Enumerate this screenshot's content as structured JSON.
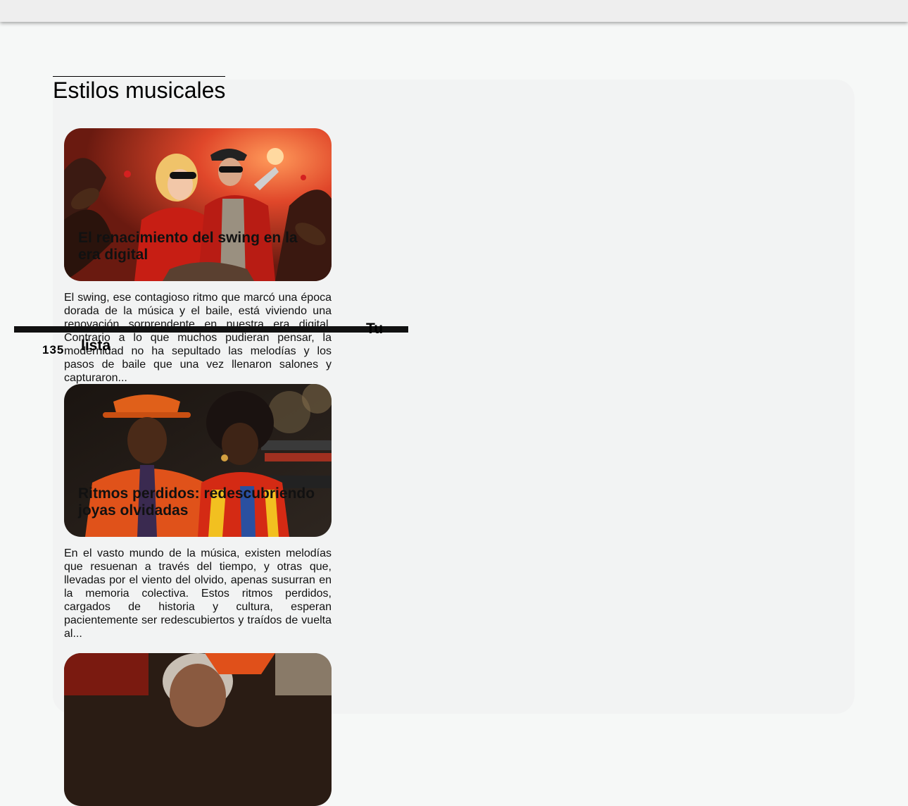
{
  "section": {
    "title": "Estilos musicales"
  },
  "articles": [
    {
      "title": "El renacimiento del swing en la era digital",
      "excerpt": "El swing, ese contagioso ritmo que marcó una época dorada de la música y el baile, está viviendo una renovación sorprendente en nuestra era digital. Contrario a lo que muchos pudieran pensar, la modernidad no ha sepultado las melodías y los pasos de baile que una vez llenaron salones y capturaron...",
      "image": "swing-couple-illustration"
    },
    {
      "title": "Ritmos perdidos: redescubriendo joyas olvidadas",
      "excerpt": "En el vasto mundo de la música, existen melodías que resuenan a través del tiempo, y otras que, llevadas por el viento del olvido, apenas susurran en la memoria colectiva. Estos ritmos perdidos, cargados de historia y cultura, esperan pacientemente ser redescubiertos y traídos de vuelta al...",
      "image": "funk-couple-photo"
    },
    {
      "image": "musician-portrait-photo"
    }
  ],
  "overlap_text": {
    "line1": "Tu",
    "line2": "lista",
    "badge": "135"
  },
  "colors": {
    "page_bg": "#f6f8f7",
    "panel_bg": "#f2f3f3",
    "topbar_bg": "#eeeeee"
  }
}
